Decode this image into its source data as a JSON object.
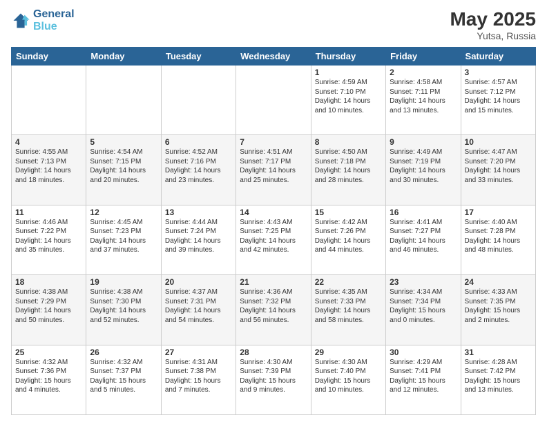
{
  "header": {
    "logo_line1": "General",
    "logo_line2": "Blue",
    "month": "May 2025",
    "location": "Yutsa, Russia"
  },
  "weekdays": [
    "Sunday",
    "Monday",
    "Tuesday",
    "Wednesday",
    "Thursday",
    "Friday",
    "Saturday"
  ],
  "rows": [
    [
      {
        "day": "",
        "sunrise": "",
        "sunset": "",
        "daylight": ""
      },
      {
        "day": "",
        "sunrise": "",
        "sunset": "",
        "daylight": ""
      },
      {
        "day": "",
        "sunrise": "",
        "sunset": "",
        "daylight": ""
      },
      {
        "day": "",
        "sunrise": "",
        "sunset": "",
        "daylight": ""
      },
      {
        "day": "1",
        "sunrise": "4:59 AM",
        "sunset": "7:10 PM",
        "daylight": "14 hours and 10 minutes."
      },
      {
        "day": "2",
        "sunrise": "4:58 AM",
        "sunset": "7:11 PM",
        "daylight": "14 hours and 13 minutes."
      },
      {
        "day": "3",
        "sunrise": "4:57 AM",
        "sunset": "7:12 PM",
        "daylight": "14 hours and 15 minutes."
      }
    ],
    [
      {
        "day": "4",
        "sunrise": "4:55 AM",
        "sunset": "7:13 PM",
        "daylight": "14 hours and 18 minutes."
      },
      {
        "day": "5",
        "sunrise": "4:54 AM",
        "sunset": "7:15 PM",
        "daylight": "14 hours and 20 minutes."
      },
      {
        "day": "6",
        "sunrise": "4:52 AM",
        "sunset": "7:16 PM",
        "daylight": "14 hours and 23 minutes."
      },
      {
        "day": "7",
        "sunrise": "4:51 AM",
        "sunset": "7:17 PM",
        "daylight": "14 hours and 25 minutes."
      },
      {
        "day": "8",
        "sunrise": "4:50 AM",
        "sunset": "7:18 PM",
        "daylight": "14 hours and 28 minutes."
      },
      {
        "day": "9",
        "sunrise": "4:49 AM",
        "sunset": "7:19 PM",
        "daylight": "14 hours and 30 minutes."
      },
      {
        "day": "10",
        "sunrise": "4:47 AM",
        "sunset": "7:20 PM",
        "daylight": "14 hours and 33 minutes."
      }
    ],
    [
      {
        "day": "11",
        "sunrise": "4:46 AM",
        "sunset": "7:22 PM",
        "daylight": "14 hours and 35 minutes."
      },
      {
        "day": "12",
        "sunrise": "4:45 AM",
        "sunset": "7:23 PM",
        "daylight": "14 hours and 37 minutes."
      },
      {
        "day": "13",
        "sunrise": "4:44 AM",
        "sunset": "7:24 PM",
        "daylight": "14 hours and 39 minutes."
      },
      {
        "day": "14",
        "sunrise": "4:43 AM",
        "sunset": "7:25 PM",
        "daylight": "14 hours and 42 minutes."
      },
      {
        "day": "15",
        "sunrise": "4:42 AM",
        "sunset": "7:26 PM",
        "daylight": "14 hours and 44 minutes."
      },
      {
        "day": "16",
        "sunrise": "4:41 AM",
        "sunset": "7:27 PM",
        "daylight": "14 hours and 46 minutes."
      },
      {
        "day": "17",
        "sunrise": "4:40 AM",
        "sunset": "7:28 PM",
        "daylight": "14 hours and 48 minutes."
      }
    ],
    [
      {
        "day": "18",
        "sunrise": "4:38 AM",
        "sunset": "7:29 PM",
        "daylight": "14 hours and 50 minutes."
      },
      {
        "day": "19",
        "sunrise": "4:38 AM",
        "sunset": "7:30 PM",
        "daylight": "14 hours and 52 minutes."
      },
      {
        "day": "20",
        "sunrise": "4:37 AM",
        "sunset": "7:31 PM",
        "daylight": "14 hours and 54 minutes."
      },
      {
        "day": "21",
        "sunrise": "4:36 AM",
        "sunset": "7:32 PM",
        "daylight": "14 hours and 56 minutes."
      },
      {
        "day": "22",
        "sunrise": "4:35 AM",
        "sunset": "7:33 PM",
        "daylight": "14 hours and 58 minutes."
      },
      {
        "day": "23",
        "sunrise": "4:34 AM",
        "sunset": "7:34 PM",
        "daylight": "15 hours and 0 minutes."
      },
      {
        "day": "24",
        "sunrise": "4:33 AM",
        "sunset": "7:35 PM",
        "daylight": "15 hours and 2 minutes."
      }
    ],
    [
      {
        "day": "25",
        "sunrise": "4:32 AM",
        "sunset": "7:36 PM",
        "daylight": "15 hours and 4 minutes."
      },
      {
        "day": "26",
        "sunrise": "4:32 AM",
        "sunset": "7:37 PM",
        "daylight": "15 hours and 5 minutes."
      },
      {
        "day": "27",
        "sunrise": "4:31 AM",
        "sunset": "7:38 PM",
        "daylight": "15 hours and 7 minutes."
      },
      {
        "day": "28",
        "sunrise": "4:30 AM",
        "sunset": "7:39 PM",
        "daylight": "15 hours and 9 minutes."
      },
      {
        "day": "29",
        "sunrise": "4:30 AM",
        "sunset": "7:40 PM",
        "daylight": "15 hours and 10 minutes."
      },
      {
        "day": "30",
        "sunrise": "4:29 AM",
        "sunset": "7:41 PM",
        "daylight": "15 hours and 12 minutes."
      },
      {
        "day": "31",
        "sunrise": "4:28 AM",
        "sunset": "7:42 PM",
        "daylight": "15 hours and 13 minutes."
      }
    ]
  ]
}
